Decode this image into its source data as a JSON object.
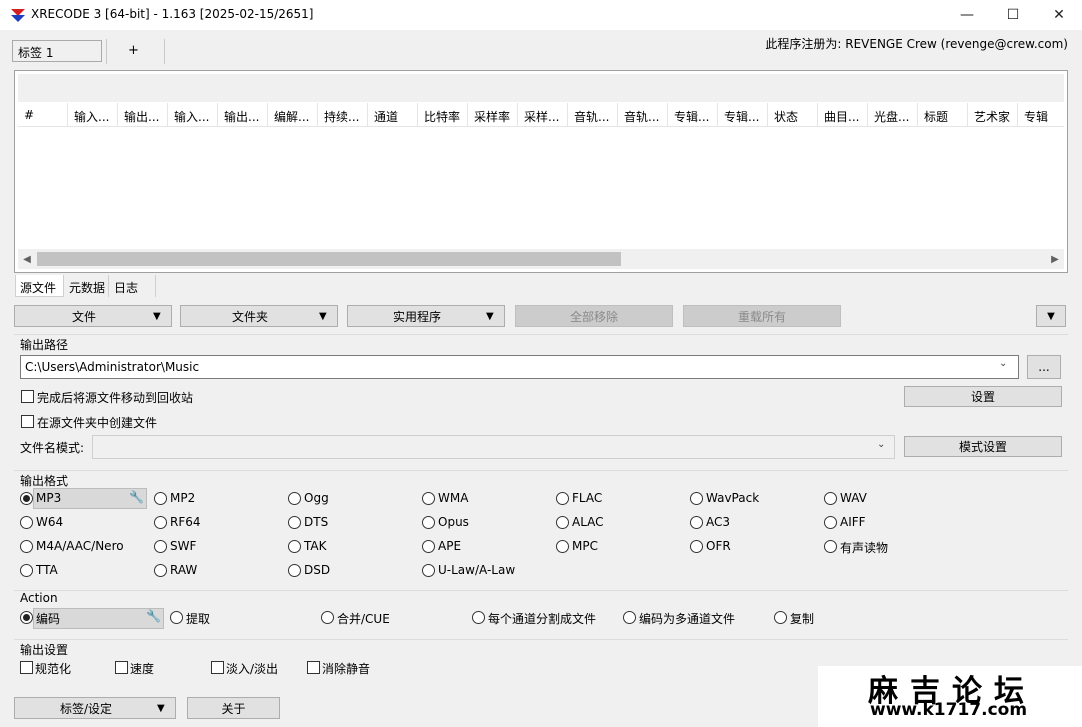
{
  "window": {
    "title": "XRECODE 3 [64-bit] - 1.163 [2025-02-15/2651]",
    "controls": {
      "minimize": "—",
      "maximize": "☐",
      "close": "✕"
    }
  },
  "tabs": {
    "active": "标签 1",
    "add": "+",
    "registration": "此程序注册为: REVENGE Crew (revenge@crew.com)"
  },
  "file_list": {
    "columns": [
      "#",
      "输入...",
      "输出...",
      "输入...",
      "输出...",
      "编解...",
      "持续...",
      "通道",
      "比特率",
      "采样率",
      "采样...",
      "音轨...",
      "音轨...",
      "专辑...",
      "专辑...",
      "状态",
      "曲目...",
      "光盘...",
      "标题",
      "艺术家",
      "专辑"
    ],
    "rows": []
  },
  "sub_tabs": [
    "源文件",
    "元数据",
    "日志"
  ],
  "toolbar": {
    "files": "文件",
    "folder": "文件夹",
    "utilities": "实用程序",
    "remove_all": "全部移除",
    "reload_all": "重载所有"
  },
  "output_path": {
    "title": "输出路径",
    "value": "C:\\Users\\Administrator\\Music",
    "browse": "...",
    "move_to_recycle": "完成后将源文件移动到回收站",
    "create_in_source": "在源文件夹中创建文件",
    "settings": "设置",
    "filename_pattern_label": "文件名模式:",
    "filename_pattern_value": "",
    "pattern_settings": "模式设置"
  },
  "output_format": {
    "title": "输出格式",
    "selected": "MP3",
    "rows": [
      [
        "MP3",
        "MP2",
        "Ogg",
        "WMA",
        "FLAC",
        "WavPack",
        "WAV"
      ],
      [
        "W64",
        "RF64",
        "DTS",
        "Opus",
        "ALAC",
        "AC3",
        "AIFF"
      ],
      [
        "M4A/AAC/Nero",
        "SWF",
        "TAK",
        "APE",
        "MPC",
        "OFR",
        "有声读物"
      ],
      [
        "TTA",
        "RAW",
        "DSD",
        "U-Law/A-Law"
      ]
    ]
  },
  "action": {
    "title": "Action",
    "selected": "编码",
    "options": [
      "编码",
      "提取",
      "合并/CUE",
      "每个通道分割成文件",
      "编码为多通道文件",
      "复制"
    ]
  },
  "output_settings": {
    "title": "输出设置",
    "options": [
      "规范化",
      "速度",
      "淡入/淡出",
      "消除静音"
    ]
  },
  "footer": {
    "tags_settings": "标签/设定",
    "about": "关于"
  },
  "watermark": {
    "title": "麻吉论坛",
    "url": "www.k1717.com"
  }
}
